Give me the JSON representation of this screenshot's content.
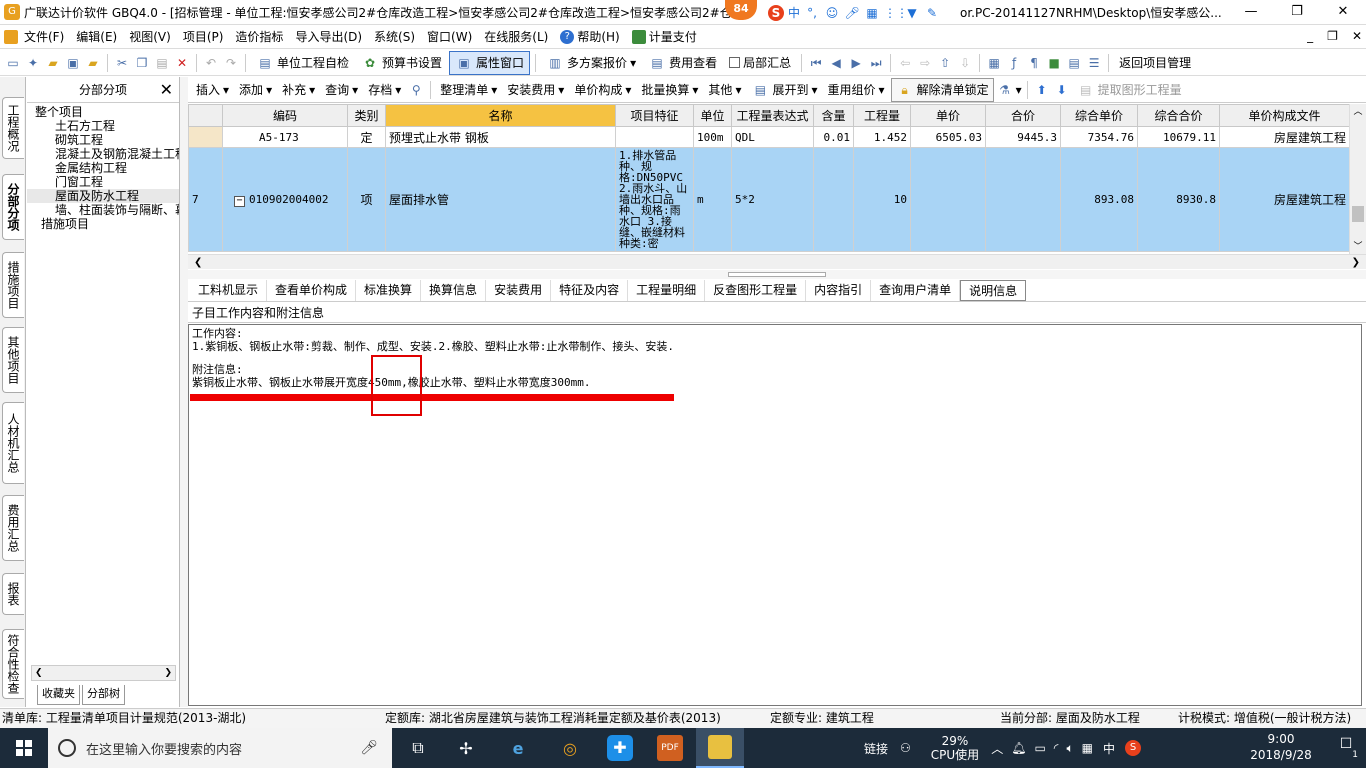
{
  "window": {
    "title": "广联达计价软件 GBQ4.0 - [招标管理 - 单位工程:恒安孝感公司2#仓库改造工程>恒安孝感公司2#仓库改造工程>恒安孝感公司2#仓库",
    "title_tail": "or.PC-20141127NRHM\\Desktop\\恒安孝感公...",
    "badge": "84",
    "minimize": "—",
    "restore": "❐",
    "close": "✕"
  },
  "menu": {
    "items": [
      "文件(F)",
      "编辑(E)",
      "视图(V)",
      "项目(P)",
      "造价指标",
      "导入导出(D)",
      "系统(S)",
      "窗口(W)",
      "在线服务(L)",
      "帮助(H)",
      "计量支付"
    ],
    "mdi_min": "_",
    "mdi_restore": "❐",
    "mdi_close": "✕"
  },
  "toolbar1": {
    "self_check": "单位工程自检",
    "budget_settings": "预算书设置",
    "property_window": "属性窗口",
    "multi_plan": "多方案报价",
    "fee_view": "费用查看",
    "partial_summary": "局部汇总",
    "return_project": "返回项目管理"
  },
  "rail_tabs": [
    "工程概况",
    "分部分项",
    "措施项目",
    "其他项目",
    "人材机汇总",
    "费用汇总",
    "报表",
    "符合性检查"
  ],
  "tree": {
    "title": "分部分项",
    "close": "✕",
    "items": [
      "整个项目",
      "土石方工程",
      "砌筑工程",
      "混凝土及钢筋混凝土工程",
      "金属结构工程",
      "门窗工程",
      "屋面及防水工程",
      "墙、柱面装饰与隔断、幕墙工程",
      "措施项目"
    ],
    "selected": "屋面及防水工程",
    "bottom_tabs": [
      "收藏夹",
      "分部树"
    ]
  },
  "toolbar2": {
    "items": [
      "插入",
      "添加",
      "补充",
      "查询",
      "存档",
      "整理清单",
      "安装费用",
      "单价构成",
      "批量换算",
      "其他",
      "展开到",
      "重用组价"
    ],
    "unlock": "解除清单锁定",
    "extract": "提取图形工程量"
  },
  "grid": {
    "headers": [
      "编码",
      "类别",
      "名称",
      "项目特征",
      "单位",
      "工程量表达式",
      "含量",
      "工程量",
      "单价",
      "合价",
      "综合单价",
      "综合合价",
      "单价构成文件"
    ],
    "rows": [
      {
        "no": "",
        "code": "A5-173",
        "type": "定",
        "name": "预埋式止水带 钢板",
        "feature": "",
        "unit": "100m",
        "expr": "QDL",
        "content": "0.01",
        "qty": "1.452",
        "price": "6505.03",
        "total": "9445.3",
        "comp_price": "7354.76",
        "comp_total": "10679.11",
        "file": "房屋建筑工程"
      },
      {
        "no": "7",
        "code": "010902004002",
        "type": "项",
        "name": "屋面排水管",
        "feature": "1.排水管品种、规格:DN50PVC 2.雨水斗、山墙出水口品种、规格:雨水口 3.接缝、嵌缝材料种类:密",
        "unit": "m",
        "expr": "5*2",
        "content": "",
        "qty": "10",
        "price": "",
        "total": "",
        "comp_price": "893.08",
        "comp_total": "8930.8",
        "file": "房屋建筑工程"
      }
    ]
  },
  "bottom_tabs": [
    "工料机显示",
    "查看单价构成",
    "标准换算",
    "换算信息",
    "安装费用",
    "特征及内容",
    "工程量明细",
    "反查图形工程量",
    "内容指引",
    "查询用户清单",
    "说明信息"
  ],
  "bottom_tab_active": "说明信息",
  "detail": {
    "header": "子目工作内容和附注信息",
    "work_label": "工作内容:",
    "work_text": "1.紫铜板、钢板止水带:剪裁、制作、成型、安装.2.橡胶、塑料止水带:止水带制作、接头、安装.",
    "note_label": "附注信息:",
    "note_text": "紫铜板止水带、钢板止水带展开宽度450mm,橡胶止水带、塑料止水带宽度300mm."
  },
  "status": {
    "list_lib": "清单库: 工程量清单项目计量规范(2013-湖北)",
    "quota_lib": "定额库: 湖北省房屋建筑与装饰工程消耗量定额及基价表(2013)",
    "quota_major": "定额专业: 建筑工程",
    "current_part": "当前分部: 屋面及防水工程",
    "tax_mode": "计税模式: 增值税(一般计税方法)"
  },
  "taskbar": {
    "search_placeholder": "在这里输入你要搜索的内容",
    "link": "链接",
    "cpu_pct": "29%",
    "cpu_label": "CPU使用",
    "ime": "中",
    "time": "9:00",
    "date": "2018/9/28",
    "notif_count": "1"
  }
}
